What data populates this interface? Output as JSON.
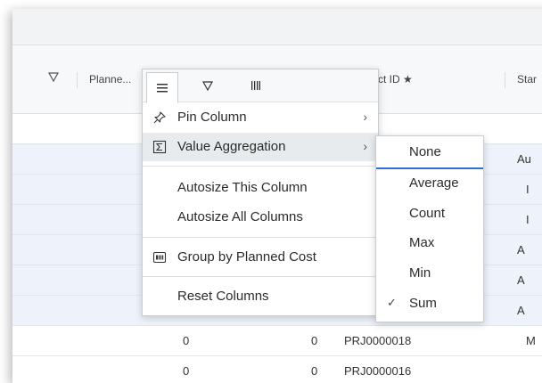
{
  "grid": {
    "header": {
      "col_planned": "Planne...",
      "col_project_id": "Project ID",
      "col_project_id_visible": "ct ID ★",
      "col_start": "Star"
    },
    "rows": [
      {
        "planned": "",
        "cost": "",
        "id": "",
        "start": ""
      },
      {
        "planned": "",
        "cost": "",
        "id": "",
        "start": "Au"
      },
      {
        "planned": "",
        "cost": "",
        "id": "",
        "start": "I"
      },
      {
        "planned": "",
        "cost": "",
        "id": "",
        "start": "I"
      },
      {
        "planned": "",
        "cost": "",
        "id": "",
        "start": "A"
      },
      {
        "planned": "",
        "cost": "",
        "id": "",
        "start": "A"
      },
      {
        "planned": "",
        "cost": "",
        "id": "",
        "start": "A"
      },
      {
        "planned": "0",
        "cost": "0",
        "id": "PRJ0000018",
        "start": "M"
      },
      {
        "planned": "0",
        "cost": "0",
        "id": "PRJ0000016",
        "start": ""
      }
    ]
  },
  "column_menu": {
    "tabs": [
      "menu-icon",
      "filter-icon",
      "columns-icon"
    ],
    "items": {
      "pin": "Pin Column",
      "aggregation": "Value Aggregation",
      "autosize_this": "Autosize This Column",
      "autosize_all": "Autosize All Columns",
      "group_by": "Group by Planned Cost",
      "reset": "Reset Columns"
    }
  },
  "aggregation_menu": {
    "options": [
      "None",
      "Average",
      "Count",
      "Max",
      "Min",
      "Sum"
    ],
    "checked": "Sum",
    "highlighted": "None"
  },
  "colors": {
    "accent": "#2f6fd6",
    "hover": "#e8ebee",
    "border": "#c9cdd2"
  }
}
